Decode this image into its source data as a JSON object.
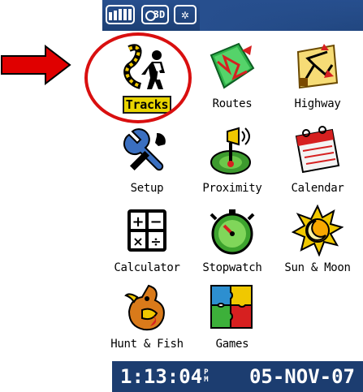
{
  "status_bar": {
    "icons": [
      "satellite-signal-icon",
      "gps-3d-fix-icon",
      "backlight-icon"
    ],
    "fix_label": "3D"
  },
  "menu": {
    "items": [
      {
        "label": "Tracks",
        "icon": "tracks-icon",
        "selected": true
      },
      {
        "label": "Routes",
        "icon": "routes-icon"
      },
      {
        "label": "Highway",
        "icon": "highway-icon"
      },
      {
        "label": "Setup",
        "icon": "setup-icon"
      },
      {
        "label": "Proximity",
        "icon": "proximity-icon"
      },
      {
        "label": "Calendar",
        "icon": "calendar-icon"
      },
      {
        "label": "Calculator",
        "icon": "calculator-icon"
      },
      {
        "label": "Stopwatch",
        "icon": "stopwatch-icon"
      },
      {
        "label": "Sun & Moon",
        "icon": "sun-moon-icon"
      },
      {
        "label": "Hunt & Fish",
        "icon": "hunt-fish-icon"
      },
      {
        "label": "Games",
        "icon": "games-icon"
      }
    ]
  },
  "footer": {
    "time": "1:13:04",
    "ampm_top": "P",
    "ampm_bottom": "M",
    "date": "05-NOV-07"
  },
  "annotation": {
    "arrow_color": "#e00000",
    "circle_color": "#d90f0f"
  }
}
